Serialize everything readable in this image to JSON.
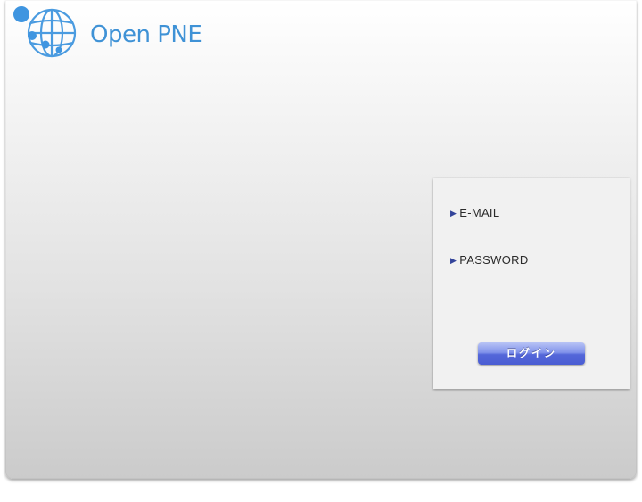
{
  "brand": {
    "name": "Open PNE",
    "logo_icon": "globe-icon",
    "color": "#3f92d6"
  },
  "login": {
    "email_label": "E-MAIL",
    "password_label": "PASSWORD",
    "submit_label": "ログイン",
    "label_arrow_icon": "triangle-right-icon",
    "button_color": "#5467d9"
  }
}
